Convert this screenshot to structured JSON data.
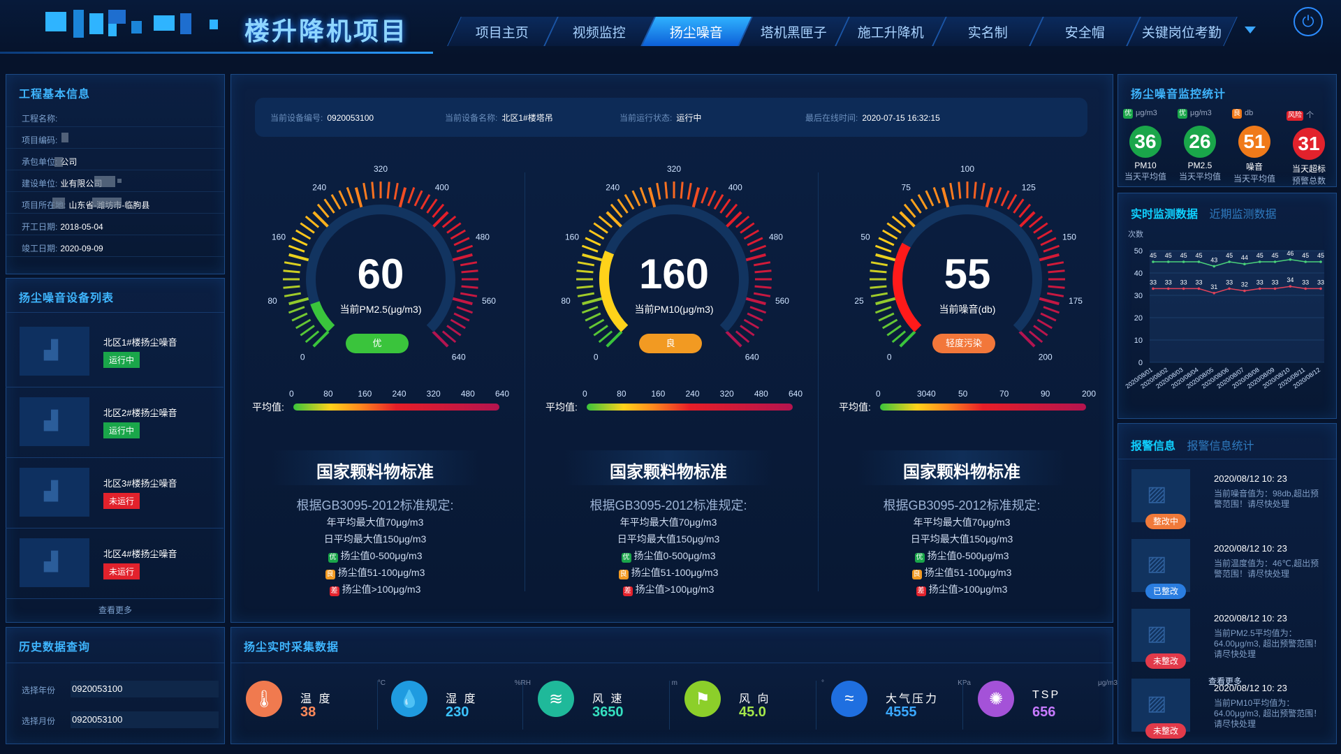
{
  "header": {
    "title": "楼升降机项目",
    "nav": [
      "项目主页",
      "视频监控",
      "扬尘噪音",
      "塔机黑匣子",
      "施工升降机",
      "实名制",
      "安全帽",
      "关键岗位考勤"
    ],
    "active_tab": "扬尘噪音"
  },
  "left": {
    "info_title": "工程基本信息",
    "info": [
      {
        "label": "工程名称:",
        "value": ""
      },
      {
        "label": "项目编码:",
        "value": ""
      },
      {
        "label": "承包单位:",
        "value": "公司"
      },
      {
        "label": "建设单位:",
        "value": "业有限公司"
      },
      {
        "label": "项目所在地:",
        "value": "山东省-潍坊市-临朐县"
      },
      {
        "label": "开工日期:",
        "value": "2018-05-04"
      },
      {
        "label": "竣工日期:",
        "value": "2020-09-09"
      }
    ],
    "devices_title": "扬尘噪音设备列表",
    "devices": [
      {
        "name": "北区1#楼扬尘噪音",
        "status": "运行中"
      },
      {
        "name": "北区2#楼扬尘噪音",
        "status": "运行中"
      },
      {
        "name": "北区3#楼扬尘噪音",
        "status": "未运行"
      },
      {
        "name": "北区4#楼扬尘噪音",
        "status": "未运行"
      }
    ],
    "more": "查看更多",
    "history_title": "历史数据查询",
    "history": [
      {
        "label": "选择年份",
        "value": "0920053100"
      },
      {
        "label": "选择月份",
        "value": "0920053100"
      }
    ]
  },
  "center": {
    "device_bar": [
      {
        "label": "当前设备编号:",
        "value": "0920053100"
      },
      {
        "label": "当前设备名称:",
        "value": "北区1#楼塔吊"
      },
      {
        "label": "当前运行状态:",
        "value": "运行中"
      },
      {
        "label": "最后在线时间:",
        "value": "2020-07-15 16:32:15"
      }
    ],
    "gauges": [
      {
        "value": "60",
        "label": "当前PM2.5(μg/m3)",
        "badge": "优",
        "badge_color": "#3ac43c",
        "ticks": [
          "0",
          "80",
          "160",
          "240",
          "320",
          "400",
          "480",
          "560",
          "640"
        ],
        "scale": [
          "0",
          "80",
          "160",
          "240",
          "320",
          "480",
          "640"
        ],
        "avg_label": "平均值:"
      },
      {
        "value": "160",
        "label": "当前PM10(μg/m3)",
        "badge": "良",
        "badge_color": "#f29a22",
        "ticks": [
          "0",
          "80",
          "160",
          "240",
          "320",
          "400",
          "480",
          "560",
          "640"
        ],
        "scale": [
          "0",
          "80",
          "160",
          "240",
          "320",
          "480",
          "640"
        ],
        "avg_label": "平均值:"
      },
      {
        "value": "55",
        "label": "当前噪音(db)",
        "badge": "轻度污染",
        "badge_color": "#f2773a",
        "ticks": [
          "0",
          "25",
          "50",
          "75",
          "100",
          "125",
          "150",
          "175",
          "200"
        ],
        "scale": [
          "0",
          "3040",
          "50",
          "70",
          "90",
          "200"
        ],
        "avg_label": "平均值:"
      }
    ],
    "standard": {
      "title": "国家颗料物标准",
      "sub": "根据GB3095-2012标准规定:",
      "lines": [
        "年平均最大值70μg/m3",
        "日平均最大值150μg/m3"
      ],
      "tags": [
        {
          "tag": "优",
          "text": "扬尘值0-500μg/m3",
          "color": "#1aa64a"
        },
        {
          "tag": "良",
          "text": "扬尘值51-100μg/m3",
          "color": "#f29a22"
        },
        {
          "tag": "差",
          "text": "扬尘值>100μg/m3",
          "color": "#e2222c"
        }
      ]
    },
    "realtime_title": "扬尘实时采集数据",
    "sensors": [
      {
        "name": "温 度",
        "value": "38",
        "unit": "°C",
        "color": "#f07a4f",
        "vcolor": "#ff8a5a",
        "icon": "thermometer-icon",
        "glyph": "🌡"
      },
      {
        "name": "湿 度",
        "value": "230",
        "unit": "%RH",
        "color": "#1f9be0",
        "vcolor": "#3cc3ff",
        "icon": "droplet-icon",
        "glyph": "💧"
      },
      {
        "name": "风 速",
        "value": "3650",
        "unit": "m",
        "color": "#1fb99a",
        "vcolor": "#35e0c0",
        "icon": "wind-icon",
        "glyph": "≋"
      },
      {
        "name": "风 向",
        "value": "45.0",
        "unit": "°",
        "color": "#8ccf2a",
        "vcolor": "#a5e84a",
        "icon": "flag-icon",
        "glyph": "⚑"
      },
      {
        "name": "大气压力",
        "value": "4555",
        "unit": "KPa",
        "color": "#1f6fe0",
        "vcolor": "#3aa8ff",
        "icon": "waves-icon",
        "glyph": "≈"
      },
      {
        "name": "TSP",
        "value": "656",
        "unit": "μg/m3",
        "color": "#a452d8",
        "vcolor": "#c77aff",
        "icon": "particles-icon",
        "glyph": "✺"
      }
    ]
  },
  "right": {
    "stats_title": "扬尘噪音监控统计",
    "stats": [
      {
        "top_tag": "优",
        "top_unit": "μg/m3",
        "value": "36",
        "l1": "PM10",
        "l2": "当天平均值",
        "color": "#1aa64a"
      },
      {
        "top_tag": "优",
        "top_unit": "μg/m3",
        "value": "26",
        "l1": "PM2.5",
        "l2": "当天平均值",
        "color": "#1aa64a"
      },
      {
        "top_tag": "良",
        "top_unit": "db",
        "value": "51",
        "l1": "噪音",
        "l2": "当天平均值",
        "color": "#f07a1a"
      },
      {
        "top_tag": "风险",
        "top_unit": "个",
        "value": "31",
        "l1": "当天超标",
        "l2": "预警总数",
        "color": "#e2222c"
      }
    ],
    "monitor_tabs": [
      "实时监测数据",
      "近期监测数据"
    ],
    "chart_data": {
      "type": "line",
      "ylabel": "次数",
      "ylim": [
        0,
        50
      ],
      "yticks": [
        "0",
        "10",
        "20",
        "30",
        "40",
        "50"
      ],
      "categories": [
        "2020/08/01",
        "2020/08/02",
        "2020/08/03",
        "2020/08/04",
        "2020/08/05",
        "2020/08/06",
        "2020/08/07",
        "2020/08/08",
        "2020/08/09",
        "2020/08/10",
        "2020/08/11",
        "2020/08/12"
      ],
      "series": [
        {
          "values": [
            45,
            45,
            45,
            45,
            43,
            45,
            44,
            45,
            45,
            46,
            45,
            45
          ],
          "color": "#4ad17a"
        },
        {
          "values": [
            33,
            33,
            33,
            33,
            31,
            33,
            32,
            33,
            33,
            34,
            33,
            33
          ],
          "color": "#e2435a"
        }
      ]
    },
    "alert_tabs": [
      "报警信息",
      "报警信息统计"
    ],
    "alerts": [
      {
        "time": "2020/08/12 10: 23",
        "msg": "当前噪音值为：98db,超出预警范围！请尽快处理",
        "badge": "整改中",
        "badge_color": "#f07a3a"
      },
      {
        "time": "2020/08/12 10: 23",
        "msg": "当前温度值为：46℃,超出预警范围！请尽快处理",
        "badge": "已整改",
        "badge_color": "#2a7de0"
      },
      {
        "time": "2020/08/12 10: 23",
        "msg": "当前PM2.5平均值为：64.00μg/m3, 超出预警范围！请尽快处理",
        "badge": "未整改",
        "badge_color": "#e23a4a"
      },
      {
        "time": "2020/08/12 10: 23",
        "msg": "当前PM10平均值为：64.00μg/m3, 超出预警范围！请尽快处理",
        "badge": "未整改",
        "badge_color": "#e23a4a"
      }
    ],
    "alerts_more": "查看更多"
  }
}
